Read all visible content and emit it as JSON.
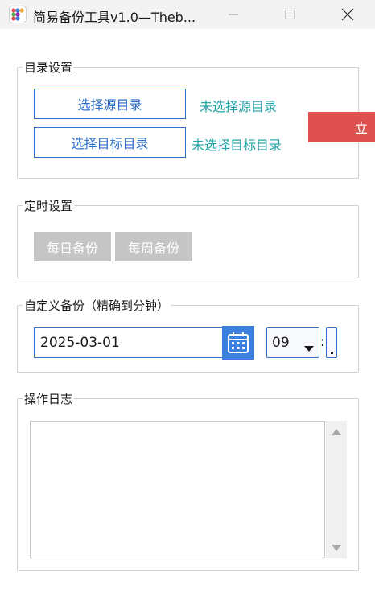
{
  "window": {
    "title": "简易备份工具v1.0—Theb...",
    "icon": "app-logo-icon"
  },
  "directory": {
    "group_title": "目录设置",
    "select_source_label": "选择源目录",
    "source_status": "未选择源目录",
    "select_target_label": "选择目标目录",
    "target_status": "未选择目标目录",
    "action_label": "立"
  },
  "schedule": {
    "group_title": "定时设置",
    "daily_label": "每日备份",
    "weekly_label": "每周备份"
  },
  "custom": {
    "group_title": "自定义备份（精确到分钟）",
    "date_value": "2025-03-01",
    "hour_value": "09",
    "separator": ":",
    "minute_value": ""
  },
  "log": {
    "group_title": "操作日志",
    "content": ""
  },
  "colors": {
    "accent_blue": "#2f6fc7",
    "status_teal": "#21a3a8",
    "danger_red": "#df5150",
    "disabled_gray": "#c5c5c5"
  }
}
